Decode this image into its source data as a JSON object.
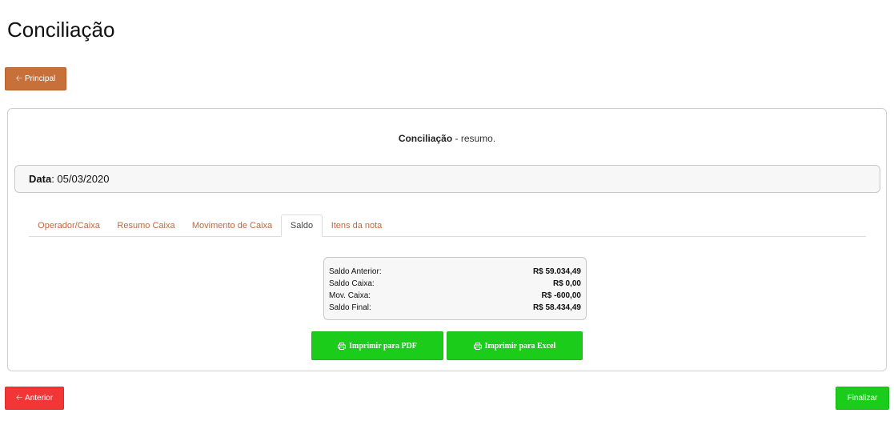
{
  "page": {
    "title": "Conciliação"
  },
  "nav": {
    "principal_label": "Principal",
    "anterior_label": "Anterior",
    "finalizar_label": "Finalizar"
  },
  "card": {
    "heading_bold": "Conciliação",
    "heading_rest": " - resumo.",
    "date_label": "Data",
    "date_value": ": 05/03/2020"
  },
  "tabs": [
    {
      "label": "Operador/Caixa",
      "active": false
    },
    {
      "label": "Resumo Caixa",
      "active": false
    },
    {
      "label": "Movimento de Caixa",
      "active": false
    },
    {
      "label": "Saldo",
      "active": true
    },
    {
      "label": "Itens da nota",
      "active": false
    }
  ],
  "saldo": [
    {
      "label": "Saldo Anterior:",
      "value": "R$ 59.034,49"
    },
    {
      "label": "Saldo Caixa:",
      "value": "R$ 0,00"
    },
    {
      "label": "Mov. Caixa:",
      "value": "R$ -600,00"
    },
    {
      "label": "Saldo Final:",
      "value": "R$ 58.434,49"
    }
  ],
  "actions": {
    "pdf_label": "Imprimir para PDF",
    "excel_label": "Imprimir para Excel"
  },
  "icons": {
    "back": "arrow-left-icon",
    "print": "print-icon"
  },
  "colors": {
    "principal": "#c8703a",
    "anterior": "#f23535",
    "success": "#1bcc1b",
    "tab_link": "#c0683a"
  }
}
